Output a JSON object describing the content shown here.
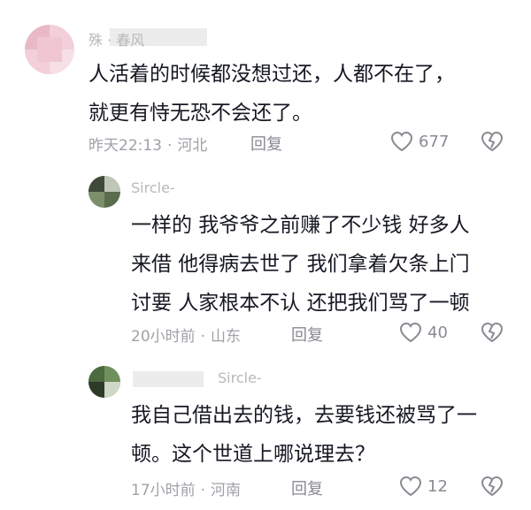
{
  "comments": [
    {
      "name": "殊 · 春风",
      "lines": [
        "人活着的时候都没想过还，人都不在了，",
        "就更有恃无恐不会还了。"
      ],
      "time": "昨天22:13",
      "location": "河北",
      "reply_label": "回复",
      "likes": "677"
    },
    {
      "name": "Sircle-",
      "lines": [
        "一样的  我爷爷之前赚了不少钱  好多人",
        "来借  他得病去世了  我们拿着欠条上门",
        "讨要  人家根本不认  还把我们骂了一顿"
      ],
      "time": "20小时前",
      "location": "山东",
      "reply_label": "回复",
      "likes": "40"
    },
    {
      "name": "Sircle-",
      "lines": [
        "我自己借出去的钱，去要钱还被骂了一",
        "顿。这个世道上哪说理去？"
      ],
      "time": "17小时前",
      "location": "河南",
      "reply_label": "回复",
      "likes": "12"
    }
  ],
  "colors": {
    "text": "#161823",
    "meta": "#a0a0a8",
    "icon": "#8a8a92"
  }
}
